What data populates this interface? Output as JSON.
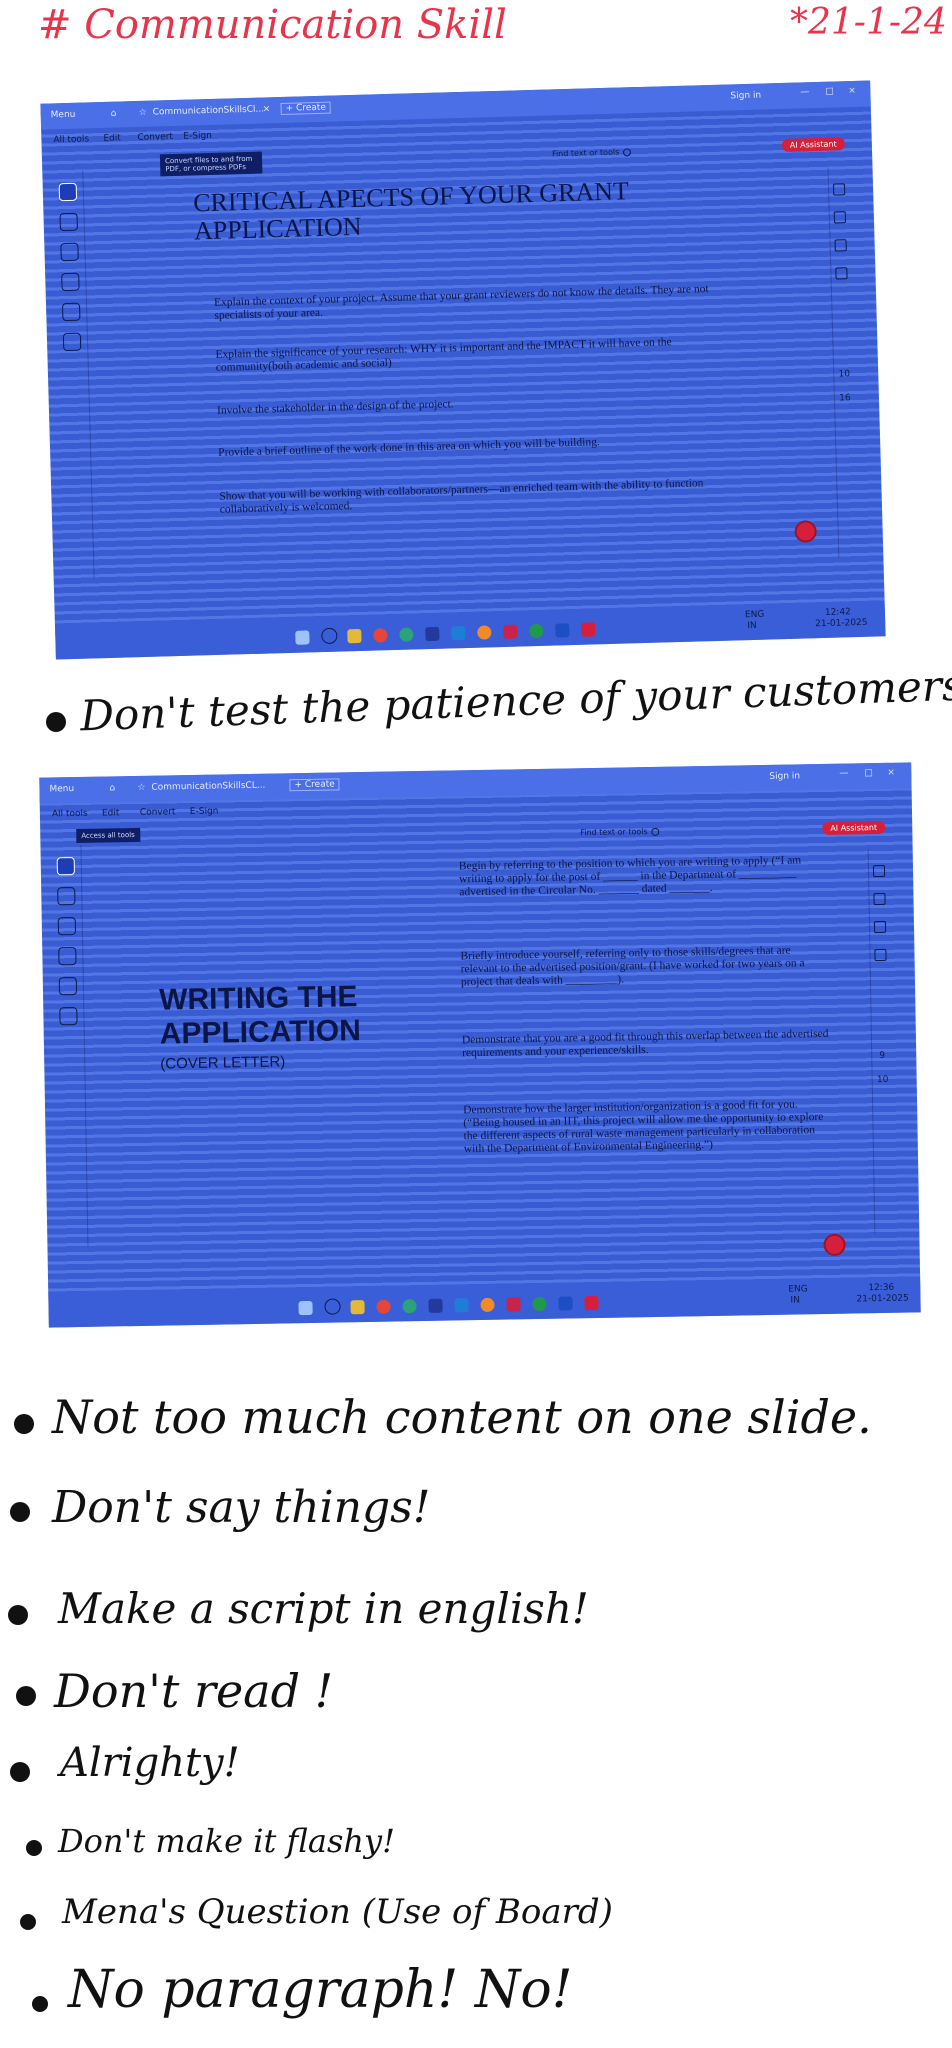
{
  "page": {
    "title": "# Communication Skill",
    "date": "*21-1-24",
    "notes": [
      "Don't test the patience of your customers",
      "Not too much content on one slide.",
      "Don't say things!",
      "Make a script in english!",
      "Don't read !",
      "Alrighty!",
      "Don't make it flashy!",
      "Mena's Question (Use of Board)",
      "No paragraph! No!"
    ]
  },
  "photo1": {
    "tab_label": "CommunicationSkillsCl...",
    "create_label": "+ Create",
    "menu_label": "Menu",
    "sign_in": "Sign in",
    "menu_items": [
      "All tools",
      "Edit",
      "Convert",
      "E-Sign"
    ],
    "tooltip": "Convert files to and from PDF, or compress PDFs",
    "search_label": "Find text or tools",
    "ai_label": "AI Assistant",
    "slide_title": "CRITICAL APECTS OF YOUR GRANT APPLICATION",
    "bullets": [
      "Explain the context of your project. Assume that your grant reviewers do not know the details. They are not specialists of your area.",
      "Explain the significance of your research: WHY it is important and the IMPACT it will have on the community(both academic and social)",
      "Involve the stakeholder in the design of the project.",
      "Provide a brief outline of the work done in this area on which you will be building.",
      "Show that you will be working with collaborators/partners—an enriched team with the ability to function collaboratively is welcomed."
    ],
    "page_nums": [
      "10",
      "16"
    ],
    "clock_time": "12:42",
    "clock_date": "21-01-2025",
    "lang": "ENG",
    "lang_sub": "IN"
  },
  "photo2": {
    "tab_label": "CommunicationSkillsCL...",
    "create_label": "+ Create",
    "menu_label": "Menu",
    "sign_in": "Sign in",
    "menu_items": [
      "All tools",
      "Edit",
      "Convert",
      "E-Sign"
    ],
    "tooltip": "Access all tools",
    "search_label": "Find text or tools",
    "ai_label": "AI Assistant",
    "slide_title_line1": "WRITING THE",
    "slide_title_line2": "APPLICATION",
    "slide_subtitle": "(COVER LETTER)",
    "bullets": [
      "Begin by referring to the position to which you are writing to apply (“I am writing to apply for the post of ______ in the Department of __________ advertised in the Circular No. _______ dated _______.",
      "Briefly introduce yourself, referring only to those skills/degrees that are relevant to the advertised position/grant. (I have worked for two years on a project that deals with _________).",
      "Demonstrate that you are a good fit through this overlap between the advertised requirements and your experience/skills.",
      "Demonstrate how the larger institution/organization is a good fit for you. (“Being housed in an IIT, this project will allow me the opportunity to explore the different aspects of rural waste management particularly in collaboration with the Department of Environmental Engineering.”)"
    ],
    "page_nums": [
      "9",
      "10"
    ],
    "clock_time": "12:36",
    "clock_date": "21-01-2025",
    "lang": "ENG",
    "lang_sub": "IN"
  },
  "colors": {
    "title_red": "#e8344a",
    "photo_blue": "#3f67e3",
    "ink": "#111111",
    "record_red": "#d6203b"
  }
}
